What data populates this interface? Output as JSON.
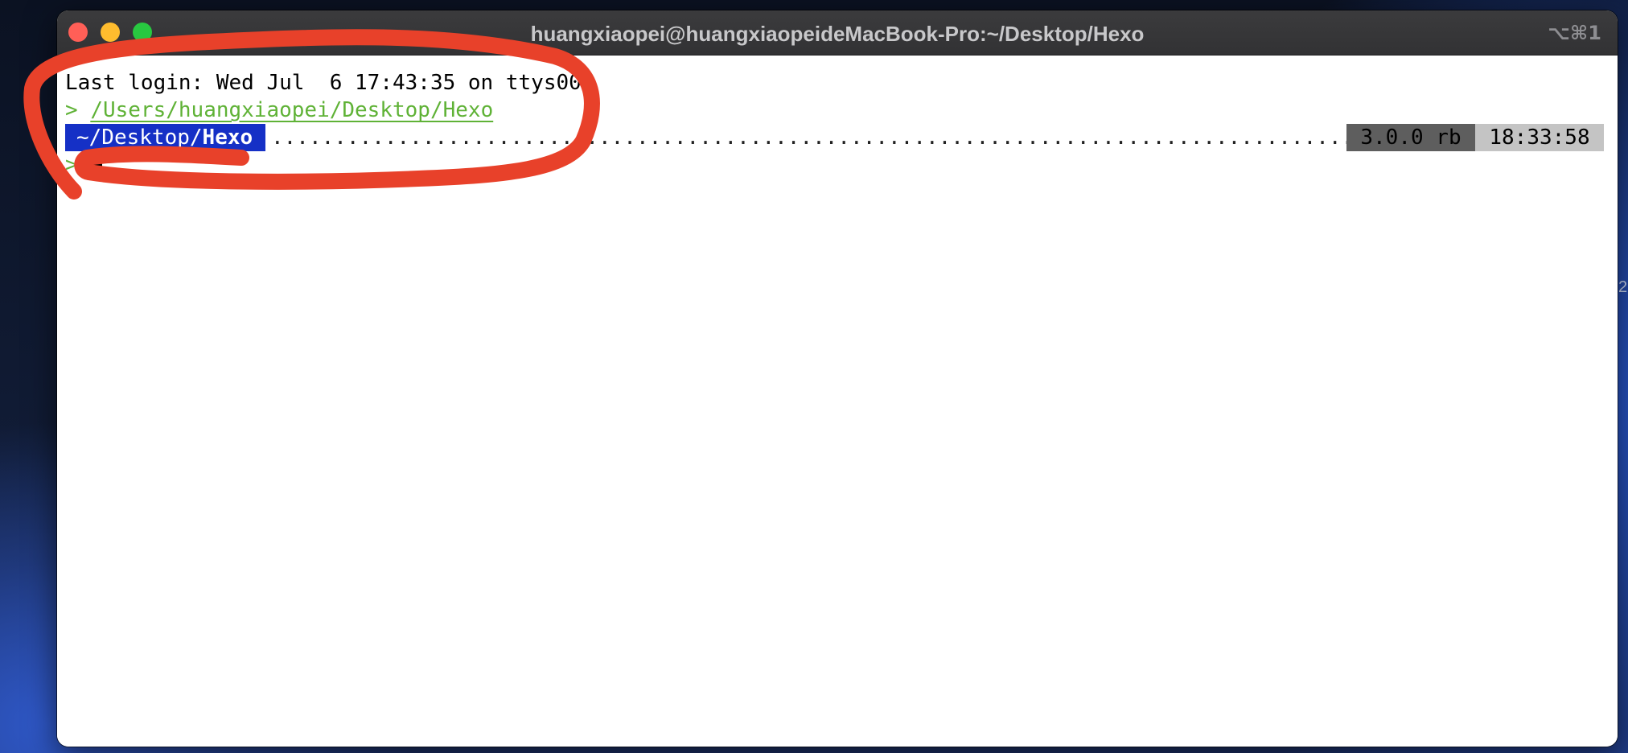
{
  "window": {
    "title": "huangxiaopei@huangxiaopeideMacBook-Pro:~/Desktop/Hexo",
    "shortcut": "⌥⌘1"
  },
  "desktop": {
    "edge_text": "2"
  },
  "terminal": {
    "last_login": "Last login: Wed Jul  6 17:43:35 on ttys000",
    "cd_prompt": "> ",
    "cd_path": "/Users/huangxiaopei/Desktop/Hexo",
    "prompt_dir_prefix": "~/Desktop/",
    "prompt_dir_bold": "Hexo",
    "dots": "........................................................................................................................................................................................................",
    "ruby_version": "3.0.0 rb",
    "time": "18:33:58",
    "input_prompt": ">"
  },
  "colors": {
    "annotation_stroke": "#e8412a",
    "prompt_green": "#5fb236",
    "dir_segment_bg": "#1530c6"
  }
}
